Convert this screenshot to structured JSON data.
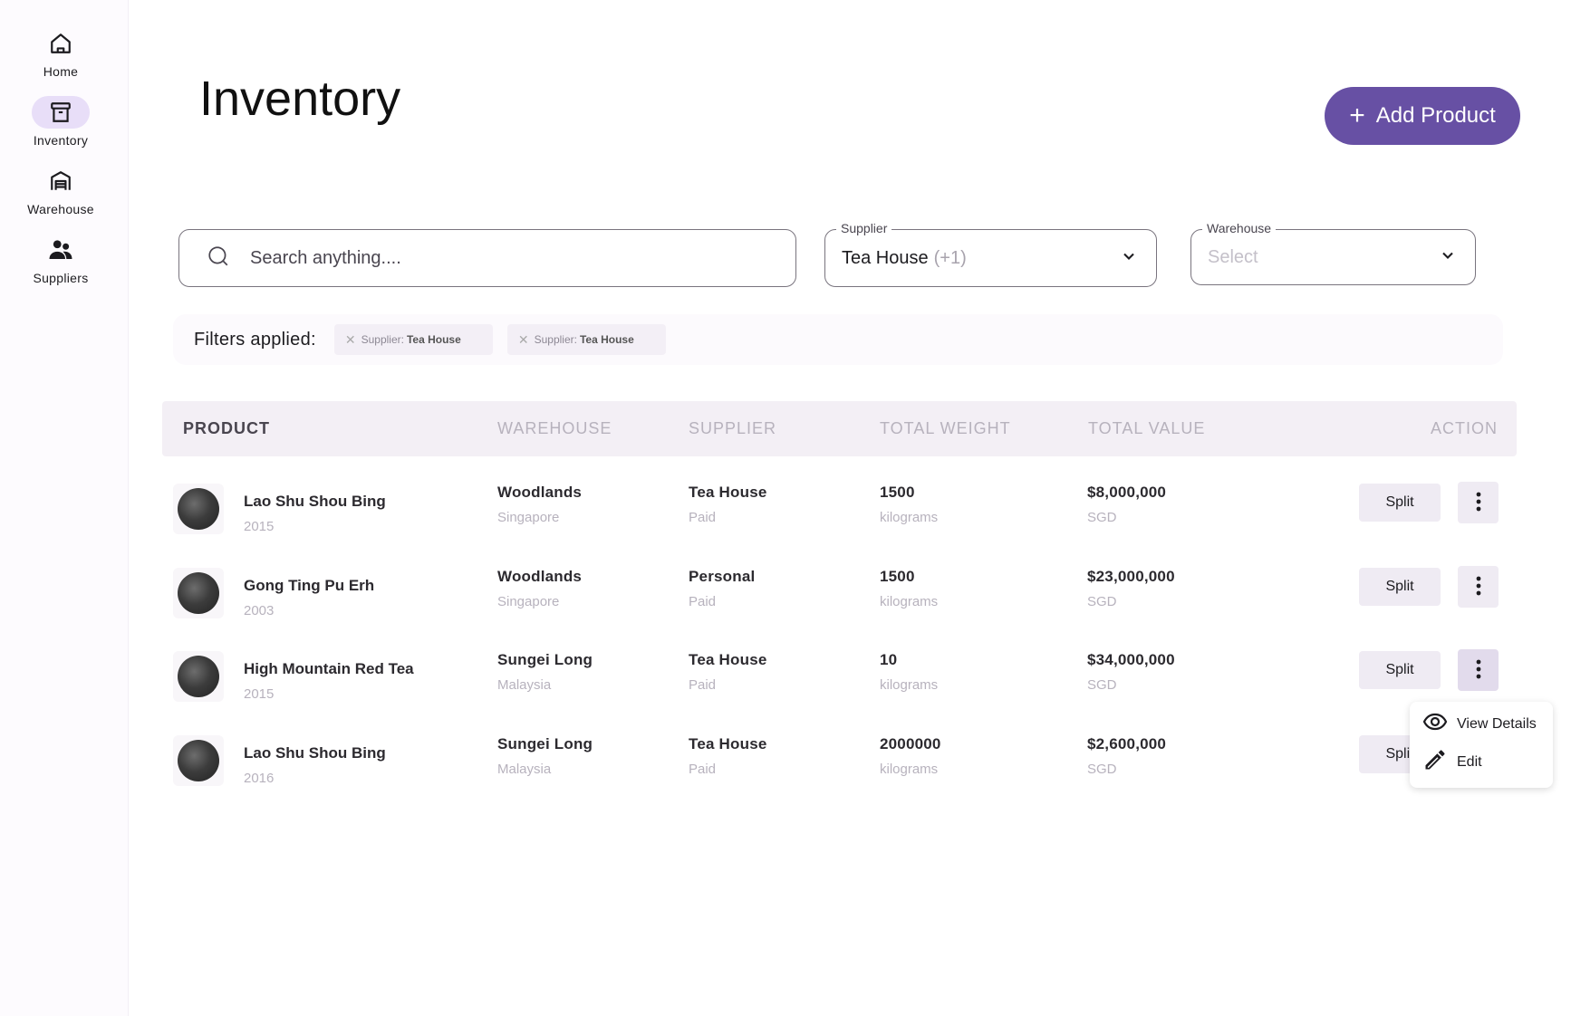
{
  "sidebar": {
    "items": [
      {
        "label": "Home",
        "icon": "home-icon",
        "active": false
      },
      {
        "label": "Inventory",
        "icon": "archive-icon",
        "active": true
      },
      {
        "label": "Warehouse",
        "icon": "warehouse-icon",
        "active": false
      },
      {
        "label": "Suppliers",
        "icon": "people-icon",
        "active": false
      }
    ]
  },
  "header": {
    "title": "Inventory",
    "add_button_label": "Add Product"
  },
  "filters": {
    "search_placeholder": "Search anything....",
    "supplier": {
      "label": "Supplier",
      "value": "Tea House",
      "extra": "(+1)"
    },
    "warehouse": {
      "label": "Warehouse",
      "placeholder": "Select"
    },
    "applied_label": "Filters applied:",
    "chips": [
      {
        "prefix": "Supplier:",
        "value": "Tea House"
      },
      {
        "prefix": "Supplier:",
        "value": "Tea House"
      }
    ]
  },
  "table": {
    "columns": [
      "PRODUCT",
      "WAREHOUSE",
      "SUPPLIER",
      "TOTAL WEIGHT",
      "TOTAL VALUE",
      "ACTION"
    ],
    "rows": [
      {
        "name": "Lao Shu Shou Bing",
        "year": "2015",
        "warehouse": "Woodlands",
        "country": "Singapore",
        "supplier": "Tea House",
        "status": "Paid",
        "weight": "1500",
        "unit": "kilograms",
        "value": "$8,000,000",
        "currency": "SGD",
        "action": "Split"
      },
      {
        "name": "Gong Ting Pu Erh",
        "year": "2003",
        "warehouse": "Woodlands",
        "country": "Singapore",
        "supplier": "Personal",
        "status": "Paid",
        "weight": "1500",
        "unit": "kilograms",
        "value": "$23,000,000",
        "currency": "SGD",
        "action": "Split"
      },
      {
        "name": "High Mountain Red Tea",
        "year": "2015",
        "warehouse": "Sungei Long",
        "country": "Malaysia",
        "supplier": "Tea House",
        "status": "Paid",
        "weight": "10",
        "unit": "kilograms",
        "value": "$34,000,000",
        "currency": "SGD",
        "action": "Split"
      },
      {
        "name": "Lao Shu Shou Bing",
        "year": "2016",
        "warehouse": "Sungei Long",
        "country": "Malaysia",
        "supplier": "Tea House",
        "status": "Paid",
        "weight": "2000000",
        "unit": "kilograms",
        "value": "$2,600,000",
        "currency": "SGD",
        "action": "Split"
      }
    ]
  },
  "menu": {
    "items": [
      {
        "label": "View Details",
        "icon": "eye-icon"
      },
      {
        "label": "Edit",
        "icon": "pencil-icon"
      }
    ]
  },
  "colors": {
    "accent": "#6750a4",
    "nav_active": "#e8def8",
    "button_bg": "#efebf3",
    "header_bg": "#f3eff5"
  }
}
